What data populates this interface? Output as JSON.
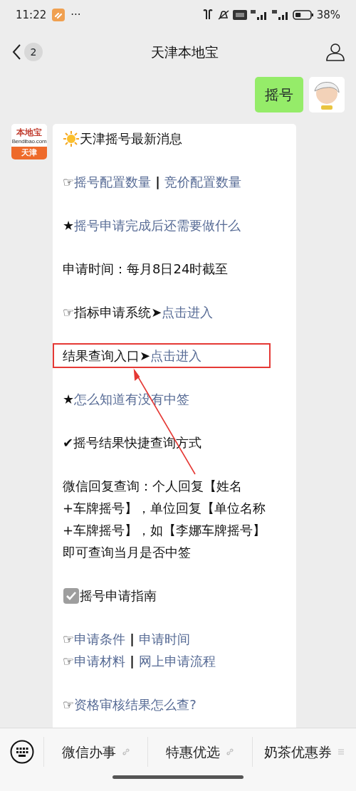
{
  "status_bar": {
    "time": "11:22",
    "more": "···",
    "battery": "38%"
  },
  "header": {
    "unread": "2",
    "title": "天津本地宝"
  },
  "sent_message": {
    "text": "摇号"
  },
  "account_logo": {
    "top": "本地宝",
    "url": "Bendibao.com",
    "bottom": "天津"
  },
  "message": {
    "blocks": [
      {
        "highlighted": false,
        "lines": [
          {
            "kind": "headline",
            "segments": [
              {
                "kind": "plain",
                "text": "天津摇号最新消息"
              }
            ]
          }
        ]
      },
      {
        "highlighted": false,
        "lines": [
          {
            "segments": [
              {
                "kind": "plain",
                "text": "☞"
              },
              {
                "kind": "link",
                "text": "摇号配置数量"
              },
              {
                "kind": "separator",
                "text": "|"
              },
              {
                "kind": "link",
                "text": "竞价配置数量"
              }
            ]
          }
        ]
      },
      {
        "highlighted": false,
        "lines": [
          {
            "segments": [
              {
                "kind": "plain",
                "text": "★"
              },
              {
                "kind": "link",
                "text": "摇号申请完成后还需要做什么"
              }
            ]
          }
        ]
      },
      {
        "highlighted": false,
        "lines": [
          {
            "segments": [
              {
                "kind": "plain",
                "text": "申请时间：每月8日24时截至"
              }
            ]
          }
        ]
      },
      {
        "highlighted": false,
        "lines": [
          {
            "segments": [
              {
                "kind": "plain",
                "text": "☞指标申请系统➤"
              },
              {
                "kind": "link",
                "text": "点击进入"
              }
            ]
          }
        ]
      },
      {
        "highlighted": true,
        "lines": [
          {
            "segments": [
              {
                "kind": "plain",
                "text": "结果查询入口➤"
              },
              {
                "kind": "link",
                "text": "点击进入"
              }
            ]
          }
        ]
      },
      {
        "highlighted": false,
        "lines": [
          {
            "segments": [
              {
                "kind": "plain",
                "text": "★"
              },
              {
                "kind": "link",
                "text": "怎么知道有没有中签"
              }
            ]
          }
        ]
      },
      {
        "highlighted": false,
        "lines": [
          {
            "segments": [
              {
                "kind": "plain",
                "text": "✔摇号结果快捷查询方式"
              }
            ]
          }
        ]
      },
      {
        "highlighted": false,
        "lines": [
          {
            "segments": [
              {
                "kind": "plain",
                "text": "微信回复查询：个人回复【姓名"
              }
            ]
          },
          {
            "segments": [
              {
                "kind": "plain",
                "text": "+车牌摇号】，单位回复【单位名称"
              }
            ]
          },
          {
            "segments": [
              {
                "kind": "plain",
                "text": "+车牌摇号】，如【李娜车牌摇号】"
              }
            ]
          },
          {
            "segments": [
              {
                "kind": "plain",
                "text": "即可查询当月是否中签"
              }
            ]
          }
        ]
      },
      {
        "highlighted": false,
        "lines": [
          {
            "kind": "section",
            "segments": [
              {
                "kind": "plain",
                "text": "摇号申请指南"
              }
            ]
          }
        ]
      },
      {
        "highlighted": false,
        "lines": [
          {
            "segments": [
              {
                "kind": "plain",
                "text": "☞"
              },
              {
                "kind": "link",
                "text": "申请条件"
              },
              {
                "kind": "separator",
                "text": "|"
              },
              {
                "kind": "link",
                "text": "申请时间"
              }
            ]
          },
          {
            "segments": [
              {
                "kind": "plain",
                "text": "☞"
              },
              {
                "kind": "link",
                "text": "申请材料"
              },
              {
                "kind": "separator",
                "text": "|"
              },
              {
                "kind": "link",
                "text": "网上申请流程"
              }
            ]
          }
        ]
      },
      {
        "highlighted": false,
        "lines": [
          {
            "segments": [
              {
                "kind": "plain",
                "text": "☞"
              },
              {
                "kind": "link",
                "text": "资格审核结果怎么查?"
              }
            ]
          }
        ]
      }
    ]
  },
  "menu_bar": {
    "items": [
      {
        "label": "微信办事",
        "kind": "link"
      },
      {
        "label": "特惠优选",
        "kind": "link"
      },
      {
        "label": "奶茶优惠券",
        "kind": "submenu"
      }
    ]
  }
}
